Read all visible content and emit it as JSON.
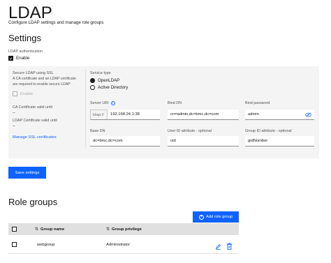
{
  "page": {
    "title": "LDAP",
    "subtitle": "Configure LDAP settings and manage role groups"
  },
  "settings": {
    "heading": "Settings",
    "ldap_auth_label": "LDAP authentication",
    "enable_label": "Enable",
    "enable_checked": true,
    "ssl": {
      "label": "Secure LDAP using SSL",
      "helper": "A CA certificate and an LDAP certificate are required to enable secure LDAP",
      "enable_label": "Enable",
      "enable_checked": false,
      "ca_cert_label": "CA Certificate valid until",
      "ca_cert_value": "--",
      "ldap_cert_label": "LDAP Certificate valid until",
      "ldap_cert_value": "--",
      "manage_link": "Manage SSL certificates"
    },
    "service_type": {
      "label": "Service type",
      "options": [
        "OpenLDAP",
        "Active Directory"
      ],
      "selected": "OpenLDAP"
    },
    "server_uri": {
      "label": "Server URI",
      "prefix": "ldap://",
      "value": "192.168.24.1:38"
    },
    "bind_dn": {
      "label": "Bind DN",
      "value": "cn=admin,dc=bmc,dc=com"
    },
    "bind_password": {
      "label": "Bind password",
      "value": "admin"
    },
    "base_dn": {
      "label": "Base DN",
      "value": "dc=bmc,dc=com"
    },
    "user_id_attr": {
      "label": "User ID attribute - optional",
      "value": "uid"
    },
    "group_id_attr": {
      "label": "Group ID attribute - optional",
      "value": "gidNumber"
    },
    "save_label": "Save settings"
  },
  "role_groups": {
    "heading": "Role groups",
    "add_label": "Add role group",
    "columns": [
      "Group name",
      "Group privilege"
    ],
    "rows": [
      {
        "group_name": "webgroup",
        "privilege": "Administrator"
      }
    ]
  },
  "colors": {
    "primary": "#0f62fe",
    "panel_bg": "#f4f4f4",
    "text": "#161616"
  }
}
